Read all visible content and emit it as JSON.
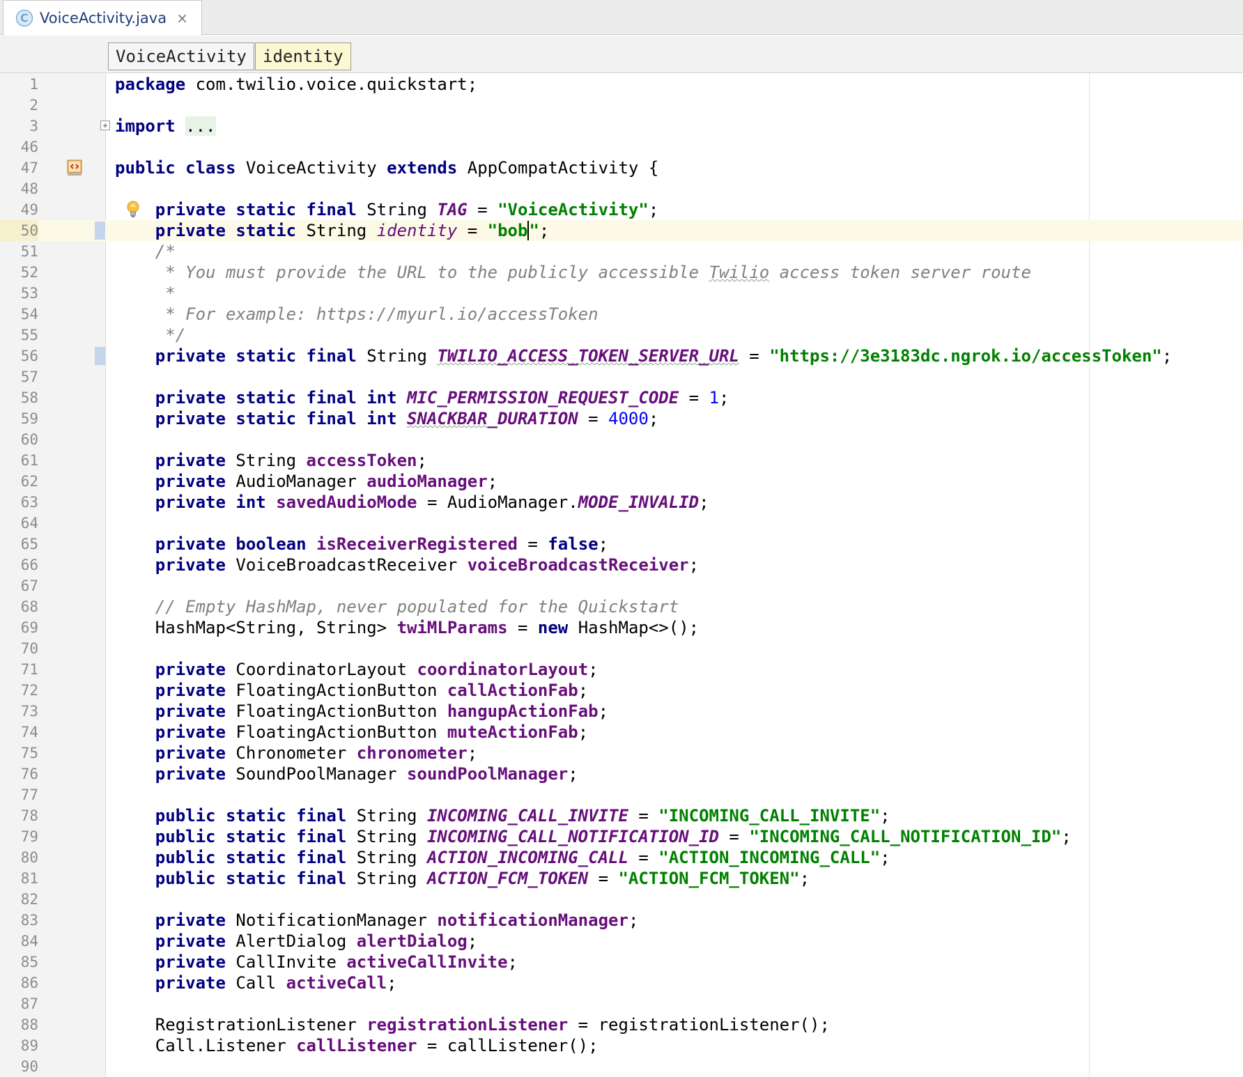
{
  "tab": {
    "file_icon": "C",
    "filename": "VoiceActivity.java",
    "close": "×"
  },
  "breadcrumbs": [
    "VoiceActivity",
    "identity"
  ],
  "editor": {
    "current_line": 50,
    "lines": [
      {
        "n": 1,
        "html": "<span class=\"k\">package</span> com.twilio.voice.quickstart;"
      },
      {
        "n": 2,
        "html": ""
      },
      {
        "n": 3,
        "html": "<span class=\"k\">import</span> <span class=\"fold\">...</span>",
        "fold": true
      },
      {
        "n": 46,
        "html": ""
      },
      {
        "n": 47,
        "html": "<span class=\"k\">public class</span> VoiceActivity <span class=\"k\">extends</span> AppCompatActivity {",
        "override": true
      },
      {
        "n": 48,
        "html": ""
      },
      {
        "n": 49,
        "html": "    <span class=\"k\">private static final</span> String <span class=\"fi\">TAG</span> = <span class=\"s\">\"VoiceActivity\"</span>;",
        "bulb": true
      },
      {
        "n": 50,
        "html": "    <span class=\"k\">private static</span> String <span class=\"sv\">identity</span> = <span class=\"s\">\"<span class=\"caret-text\">bob</span>\"</span>;",
        "vcs": true
      },
      {
        "n": 51,
        "html": "    <span class=\"c\">/*</span>"
      },
      {
        "n": 52,
        "html": "     <span class=\"c\">* You must provide the URL to the publicly accessible <span class=\"typo\">Twilio</span> access token server route</span>"
      },
      {
        "n": 53,
        "html": "     <span class=\"c\">*</span>"
      },
      {
        "n": 54,
        "html": "     <span class=\"c\">* For example: https://myurl.io/accessToken</span>"
      },
      {
        "n": 55,
        "html": "     <span class=\"c\">*/</span>"
      },
      {
        "n": 56,
        "html": "    <span class=\"k\">private static final</span> String <span class=\"fi typo\">TWILIO_ACCESS_TOKEN_SERVER_URL</span> = <span class=\"s\">\"https://3e3183dc.ngrok.io/accessToken\"</span>;",
        "vcs": true
      },
      {
        "n": 57,
        "html": ""
      },
      {
        "n": 58,
        "html": "    <span class=\"k\">private static final int</span> <span class=\"fi\">MIC_PERMISSION_REQUEST_CODE</span> = <span class=\"n\">1</span>;"
      },
      {
        "n": 59,
        "html": "    <span class=\"k\">private static final int</span> <span class=\"fi typo\">SNACKBAR</span><span class=\"fi\">_DURATION</span> = <span class=\"n\">4000</span>;"
      },
      {
        "n": 60,
        "html": ""
      },
      {
        "n": 61,
        "html": "    <span class=\"k\">private</span> String <span class=\"f\">accessToken</span>;"
      },
      {
        "n": 62,
        "html": "    <span class=\"k\">private</span> AudioManager <span class=\"f\">audioManager</span>;"
      },
      {
        "n": 63,
        "html": "    <span class=\"k\">private int</span> <span class=\"f\">savedAudioMode</span> = AudioManager.<span class=\"fi\">MODE_INVALID</span>;"
      },
      {
        "n": 64,
        "html": ""
      },
      {
        "n": 65,
        "html": "    <span class=\"k\">private boolean</span> <span class=\"f\">isReceiverRegistered</span> = <span class=\"k\">false</span>;"
      },
      {
        "n": 66,
        "html": "    <span class=\"k\">private</span> VoiceBroadcastReceiver <span class=\"f\">voiceBroadcastReceiver</span>;"
      },
      {
        "n": 67,
        "html": ""
      },
      {
        "n": 68,
        "html": "    <span class=\"c\">// Empty HashMap, never populated for the Quickstart</span>"
      },
      {
        "n": 69,
        "html": "    HashMap&lt;String, String&gt; <span class=\"f\">twiMLParams</span> = <span class=\"k\">new</span> HashMap&lt;&gt;();"
      },
      {
        "n": 70,
        "html": ""
      },
      {
        "n": 71,
        "html": "    <span class=\"k\">private</span> CoordinatorLayout <span class=\"f\">coordinatorLayout</span>;"
      },
      {
        "n": 72,
        "html": "    <span class=\"k\">private</span> FloatingActionButton <span class=\"f\">callActionFab</span>;"
      },
      {
        "n": 73,
        "html": "    <span class=\"k\">private</span> FloatingActionButton <span class=\"f\">hangupActionFab</span>;"
      },
      {
        "n": 74,
        "html": "    <span class=\"k\">private</span> FloatingActionButton <span class=\"f\">muteActionFab</span>;"
      },
      {
        "n": 75,
        "html": "    <span class=\"k\">private</span> Chronometer <span class=\"f\">chronometer</span>;"
      },
      {
        "n": 76,
        "html": "    <span class=\"k\">private</span> SoundPoolManager <span class=\"f\">soundPoolManager</span>;"
      },
      {
        "n": 77,
        "html": ""
      },
      {
        "n": 78,
        "html": "    <span class=\"k\">public static final</span> String <span class=\"fi\">INCOMING_CALL_INVITE</span> = <span class=\"s\">\"INCOMING_CALL_INVITE\"</span>;"
      },
      {
        "n": 79,
        "html": "    <span class=\"k\">public static final</span> String <span class=\"fi\">INCOMING_CALL_NOTIFICATION_ID</span> = <span class=\"s\">\"INCOMING_CALL_NOTIFICATION_ID\"</span>;"
      },
      {
        "n": 80,
        "html": "    <span class=\"k\">public static final</span> String <span class=\"fi\">ACTION_INCOMING_CALL</span> = <span class=\"s\">\"ACTION_INCOMING_CALL\"</span>;"
      },
      {
        "n": 81,
        "html": "    <span class=\"k\">public static final</span> String <span class=\"fi\">ACTION_FCM_TOKEN</span> = <span class=\"s\">\"ACTION_FCM_TOKEN\"</span>;"
      },
      {
        "n": 82,
        "html": ""
      },
      {
        "n": 83,
        "html": "    <span class=\"k\">private</span> NotificationManager <span class=\"f\">notificationManager</span>;"
      },
      {
        "n": 84,
        "html": "    <span class=\"k\">private</span> AlertDialog <span class=\"f\">alertDialog</span>;"
      },
      {
        "n": 85,
        "html": "    <span class=\"k\">private</span> CallInvite <span class=\"f\">activeCallInvite</span>;"
      },
      {
        "n": 86,
        "html": "    <span class=\"k\">private</span> Call <span class=\"f\">activeCall</span>;"
      },
      {
        "n": 87,
        "html": ""
      },
      {
        "n": 88,
        "html": "    RegistrationListener <span class=\"f\">registrationListener</span> = registrationListener();"
      },
      {
        "n": 89,
        "html": "    Call.Listener <span class=\"f\">callListener</span> = callListener();"
      },
      {
        "n": 90,
        "html": ""
      }
    ]
  }
}
